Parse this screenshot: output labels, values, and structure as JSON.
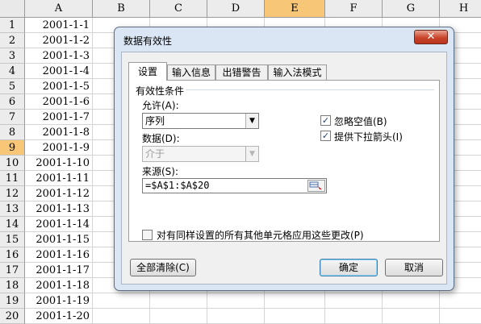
{
  "sheet": {
    "columns": [
      "A",
      "B",
      "C",
      "D",
      "E",
      "F",
      "G",
      "H"
    ],
    "rows": [
      {
        "num": "1",
        "a": "2001-1-1"
      },
      {
        "num": "2",
        "a": "2001-1-2"
      },
      {
        "num": "3",
        "a": "2001-1-3"
      },
      {
        "num": "4",
        "a": "2001-1-4"
      },
      {
        "num": "5",
        "a": "2001-1-5"
      },
      {
        "num": "6",
        "a": "2001-1-6"
      },
      {
        "num": "7",
        "a": "2001-1-7"
      },
      {
        "num": "8",
        "a": "2001-1-8"
      },
      {
        "num": "9",
        "a": "2001-1-9"
      },
      {
        "num": "10",
        "a": "2001-1-10"
      },
      {
        "num": "11",
        "a": "2001-1-11"
      },
      {
        "num": "12",
        "a": "2001-1-12"
      },
      {
        "num": "13",
        "a": "2001-1-13"
      },
      {
        "num": "14",
        "a": "2001-1-14"
      },
      {
        "num": "15",
        "a": "2001-1-15"
      },
      {
        "num": "16",
        "a": "2001-1-16"
      },
      {
        "num": "17",
        "a": "2001-1-17"
      },
      {
        "num": "18",
        "a": "2001-1-18"
      },
      {
        "num": "19",
        "a": "2001-1-19"
      },
      {
        "num": "20",
        "a": "2001-1-20"
      }
    ],
    "selected_column": "E",
    "selected_row": "9",
    "highlight_color": "#f7c777"
  },
  "dialog": {
    "title": "数据有效性",
    "close_glyph": "✕",
    "tabs": [
      "设置",
      "输入信息",
      "出错警告",
      "输入法模式"
    ],
    "active_tab": "设置",
    "group_title": "有效性条件",
    "allow_label": "允许(A):",
    "allow_value": "序列",
    "data_label": "数据(D):",
    "data_value": "介于",
    "source_label": "来源(S):",
    "source_value": "=$A$1:$A$20",
    "ignore_blank_label": "忽略空值(B)",
    "ignore_blank_checked": true,
    "dropdown_label": "提供下拉箭头(I)",
    "dropdown_checked": true,
    "apply_all_label": "对有同样设置的所有其他单元格应用这些更改(P)",
    "apply_all_checked": false,
    "clear_all_button": "全部清除(C)",
    "ok_button": "确定",
    "cancel_button": "取消",
    "check_glyph": "✓",
    "dropdown_glyph": "▼"
  }
}
